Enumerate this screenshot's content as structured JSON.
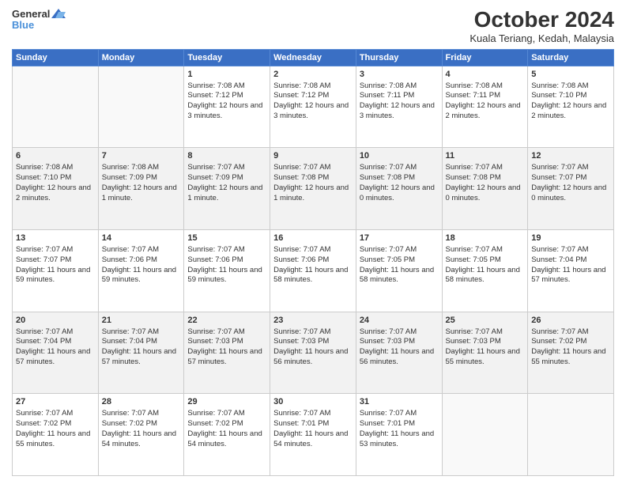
{
  "header": {
    "logo_line1": "General",
    "logo_line2": "Blue",
    "title": "October 2024",
    "subtitle": "Kuala Teriang, Kedah, Malaysia"
  },
  "days_of_week": [
    "Sunday",
    "Monday",
    "Tuesday",
    "Wednesday",
    "Thursday",
    "Friday",
    "Saturday"
  ],
  "weeks": [
    {
      "bg": "light",
      "days": [
        {
          "num": "",
          "sunrise": "",
          "sunset": "",
          "daylight": ""
        },
        {
          "num": "",
          "sunrise": "",
          "sunset": "",
          "daylight": ""
        },
        {
          "num": "1",
          "sunrise": "Sunrise: 7:08 AM",
          "sunset": "Sunset: 7:12 PM",
          "daylight": "Daylight: 12 hours and 3 minutes."
        },
        {
          "num": "2",
          "sunrise": "Sunrise: 7:08 AM",
          "sunset": "Sunset: 7:12 PM",
          "daylight": "Daylight: 12 hours and 3 minutes."
        },
        {
          "num": "3",
          "sunrise": "Sunrise: 7:08 AM",
          "sunset": "Sunset: 7:11 PM",
          "daylight": "Daylight: 12 hours and 3 minutes."
        },
        {
          "num": "4",
          "sunrise": "Sunrise: 7:08 AM",
          "sunset": "Sunset: 7:11 PM",
          "daylight": "Daylight: 12 hours and 2 minutes."
        },
        {
          "num": "5",
          "sunrise": "Sunrise: 7:08 AM",
          "sunset": "Sunset: 7:10 PM",
          "daylight": "Daylight: 12 hours and 2 minutes."
        }
      ]
    },
    {
      "bg": "gray",
      "days": [
        {
          "num": "6",
          "sunrise": "Sunrise: 7:08 AM",
          "sunset": "Sunset: 7:10 PM",
          "daylight": "Daylight: 12 hours and 2 minutes."
        },
        {
          "num": "7",
          "sunrise": "Sunrise: 7:08 AM",
          "sunset": "Sunset: 7:09 PM",
          "daylight": "Daylight: 12 hours and 1 minute."
        },
        {
          "num": "8",
          "sunrise": "Sunrise: 7:07 AM",
          "sunset": "Sunset: 7:09 PM",
          "daylight": "Daylight: 12 hours and 1 minute."
        },
        {
          "num": "9",
          "sunrise": "Sunrise: 7:07 AM",
          "sunset": "Sunset: 7:08 PM",
          "daylight": "Daylight: 12 hours and 1 minute."
        },
        {
          "num": "10",
          "sunrise": "Sunrise: 7:07 AM",
          "sunset": "Sunset: 7:08 PM",
          "daylight": "Daylight: 12 hours and 0 minutes."
        },
        {
          "num": "11",
          "sunrise": "Sunrise: 7:07 AM",
          "sunset": "Sunset: 7:08 PM",
          "daylight": "Daylight: 12 hours and 0 minutes."
        },
        {
          "num": "12",
          "sunrise": "Sunrise: 7:07 AM",
          "sunset": "Sunset: 7:07 PM",
          "daylight": "Daylight: 12 hours and 0 minutes."
        }
      ]
    },
    {
      "bg": "light",
      "days": [
        {
          "num": "13",
          "sunrise": "Sunrise: 7:07 AM",
          "sunset": "Sunset: 7:07 PM",
          "daylight": "Daylight: 11 hours and 59 minutes."
        },
        {
          "num": "14",
          "sunrise": "Sunrise: 7:07 AM",
          "sunset": "Sunset: 7:06 PM",
          "daylight": "Daylight: 11 hours and 59 minutes."
        },
        {
          "num": "15",
          "sunrise": "Sunrise: 7:07 AM",
          "sunset": "Sunset: 7:06 PM",
          "daylight": "Daylight: 11 hours and 59 minutes."
        },
        {
          "num": "16",
          "sunrise": "Sunrise: 7:07 AM",
          "sunset": "Sunset: 7:06 PM",
          "daylight": "Daylight: 11 hours and 58 minutes."
        },
        {
          "num": "17",
          "sunrise": "Sunrise: 7:07 AM",
          "sunset": "Sunset: 7:05 PM",
          "daylight": "Daylight: 11 hours and 58 minutes."
        },
        {
          "num": "18",
          "sunrise": "Sunrise: 7:07 AM",
          "sunset": "Sunset: 7:05 PM",
          "daylight": "Daylight: 11 hours and 58 minutes."
        },
        {
          "num": "19",
          "sunrise": "Sunrise: 7:07 AM",
          "sunset": "Sunset: 7:04 PM",
          "daylight": "Daylight: 11 hours and 57 minutes."
        }
      ]
    },
    {
      "bg": "gray",
      "days": [
        {
          "num": "20",
          "sunrise": "Sunrise: 7:07 AM",
          "sunset": "Sunset: 7:04 PM",
          "daylight": "Daylight: 11 hours and 57 minutes."
        },
        {
          "num": "21",
          "sunrise": "Sunrise: 7:07 AM",
          "sunset": "Sunset: 7:04 PM",
          "daylight": "Daylight: 11 hours and 57 minutes."
        },
        {
          "num": "22",
          "sunrise": "Sunrise: 7:07 AM",
          "sunset": "Sunset: 7:03 PM",
          "daylight": "Daylight: 11 hours and 57 minutes."
        },
        {
          "num": "23",
          "sunrise": "Sunrise: 7:07 AM",
          "sunset": "Sunset: 7:03 PM",
          "daylight": "Daylight: 11 hours and 56 minutes."
        },
        {
          "num": "24",
          "sunrise": "Sunrise: 7:07 AM",
          "sunset": "Sunset: 7:03 PM",
          "daylight": "Daylight: 11 hours and 56 minutes."
        },
        {
          "num": "25",
          "sunrise": "Sunrise: 7:07 AM",
          "sunset": "Sunset: 7:03 PM",
          "daylight": "Daylight: 11 hours and 55 minutes."
        },
        {
          "num": "26",
          "sunrise": "Sunrise: 7:07 AM",
          "sunset": "Sunset: 7:02 PM",
          "daylight": "Daylight: 11 hours and 55 minutes."
        }
      ]
    },
    {
      "bg": "light",
      "days": [
        {
          "num": "27",
          "sunrise": "Sunrise: 7:07 AM",
          "sunset": "Sunset: 7:02 PM",
          "daylight": "Daylight: 11 hours and 55 minutes."
        },
        {
          "num": "28",
          "sunrise": "Sunrise: 7:07 AM",
          "sunset": "Sunset: 7:02 PM",
          "daylight": "Daylight: 11 hours and 54 minutes."
        },
        {
          "num": "29",
          "sunrise": "Sunrise: 7:07 AM",
          "sunset": "Sunset: 7:02 PM",
          "daylight": "Daylight: 11 hours and 54 minutes."
        },
        {
          "num": "30",
          "sunrise": "Sunrise: 7:07 AM",
          "sunset": "Sunset: 7:01 PM",
          "daylight": "Daylight: 11 hours and 54 minutes."
        },
        {
          "num": "31",
          "sunrise": "Sunrise: 7:07 AM",
          "sunset": "Sunset: 7:01 PM",
          "daylight": "Daylight: 11 hours and 53 minutes."
        },
        {
          "num": "",
          "sunrise": "",
          "sunset": "",
          "daylight": ""
        },
        {
          "num": "",
          "sunrise": "",
          "sunset": "",
          "daylight": ""
        }
      ]
    }
  ]
}
